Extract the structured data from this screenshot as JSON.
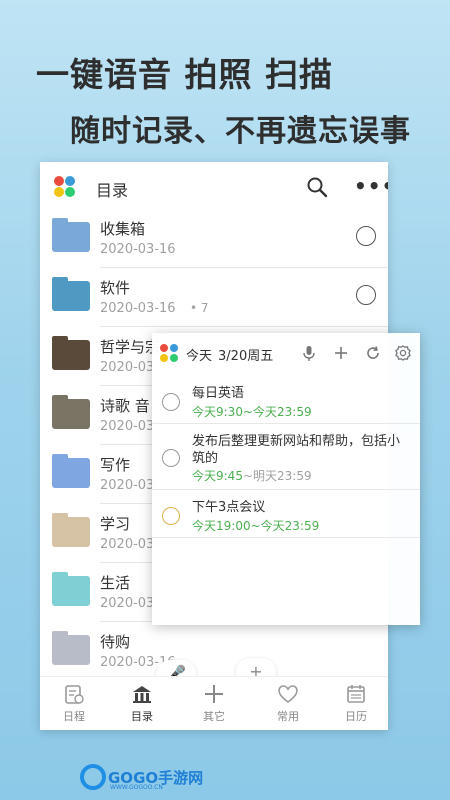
{
  "promo": {
    "line1": "一键语音 拍照 扫描",
    "line2": "随时记录、不再遗忘误事"
  },
  "topbar": {
    "title": "目录",
    "search_icon": "search-icon",
    "more_icon": "more-icon",
    "more_glyph": "•••"
  },
  "folders": [
    {
      "name": "收集箱",
      "date": "2020-03-16",
      "color": "#7aa8d8",
      "icon": "inbox-folder-icon"
    },
    {
      "name": "软件",
      "date": "2020-03-16",
      "count": "• 7",
      "color": "#4f9ac2",
      "icon": "software-folder-icon"
    },
    {
      "name": "哲学与宗",
      "date": "2020-03-",
      "color": "#5a4a3a",
      "icon": "philosophy-folder-icon"
    },
    {
      "name": "诗歌 音",
      "date": "2020-03-",
      "color": "#7a7464",
      "icon": "poetry-folder-icon"
    },
    {
      "name": "写作",
      "date": "2020-03-",
      "color": "#7fa6e0",
      "icon": "writing-folder-icon"
    },
    {
      "name": "学习",
      "date": "2020-03-",
      "color": "#d6c2a4",
      "icon": "study-folder-icon"
    },
    {
      "name": "生活",
      "date": "2020-03-",
      "color": "#7fd0d4",
      "icon": "life-folder-icon"
    },
    {
      "name": "待购",
      "date": "2020-03-16",
      "color": "#b8bcc8",
      "icon": "shopping-folder-icon"
    }
  ],
  "floating": {
    "mic_glyph": "🎤",
    "plus_glyph": "+"
  },
  "tabs": [
    {
      "label": "日程",
      "icon": "schedule-icon"
    },
    {
      "label": "目录",
      "icon": "catalog-icon",
      "active": true
    },
    {
      "label": "其它",
      "icon": "plus-icon"
    },
    {
      "label": "常用",
      "icon": "heart-icon"
    },
    {
      "label": "日历",
      "icon": "calendar-icon"
    }
  ],
  "today": {
    "title": "今天",
    "date": "3/20周五",
    "tasks": [
      {
        "title": "每日英语",
        "time_start": "今天9:30",
        "time_sep": "~",
        "time_end": "今天23:59"
      },
      {
        "title": "发布后整理更新网站和帮助，包括小筑的",
        "time_start": "今天9:45",
        "time_sep": "~",
        "time_end": "明天23:59"
      },
      {
        "title": "下午3点会议",
        "time_start": "今天19:00",
        "time_sep": "~",
        "time_end": "今天23:59"
      }
    ]
  },
  "footer": {
    "brand": "GOGO手游网",
    "sub": "WWW.GOGOO.CN"
  },
  "colors": {
    "accent_green": "#4caf50",
    "brand_blue": "#1f8fe5"
  }
}
